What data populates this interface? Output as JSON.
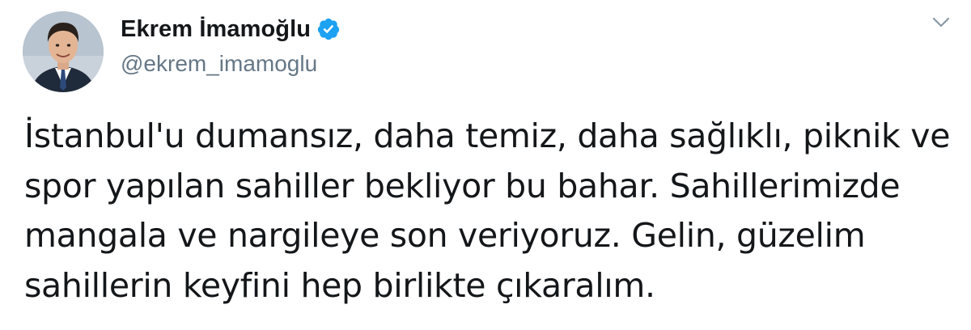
{
  "user": {
    "display_name": "Ekrem İmamoğlu",
    "handle": "@ekrem_imamoglu",
    "verified": true,
    "verified_color": "#1da1f2"
  },
  "menu": {
    "icon": "chevron-down-icon"
  },
  "tweet": {
    "lines": [
      "İstanbul'u dumansız, daha temiz, daha sağlıklı, piknik ve",
      "spor yapılan sahiller bekliyor bu bahar. Sahillerimizde",
      "mangala ve nargileye son veriyoruz. Gelin, güzelim",
      "sahillerin keyfini hep birlikte çıkaralım."
    ]
  }
}
